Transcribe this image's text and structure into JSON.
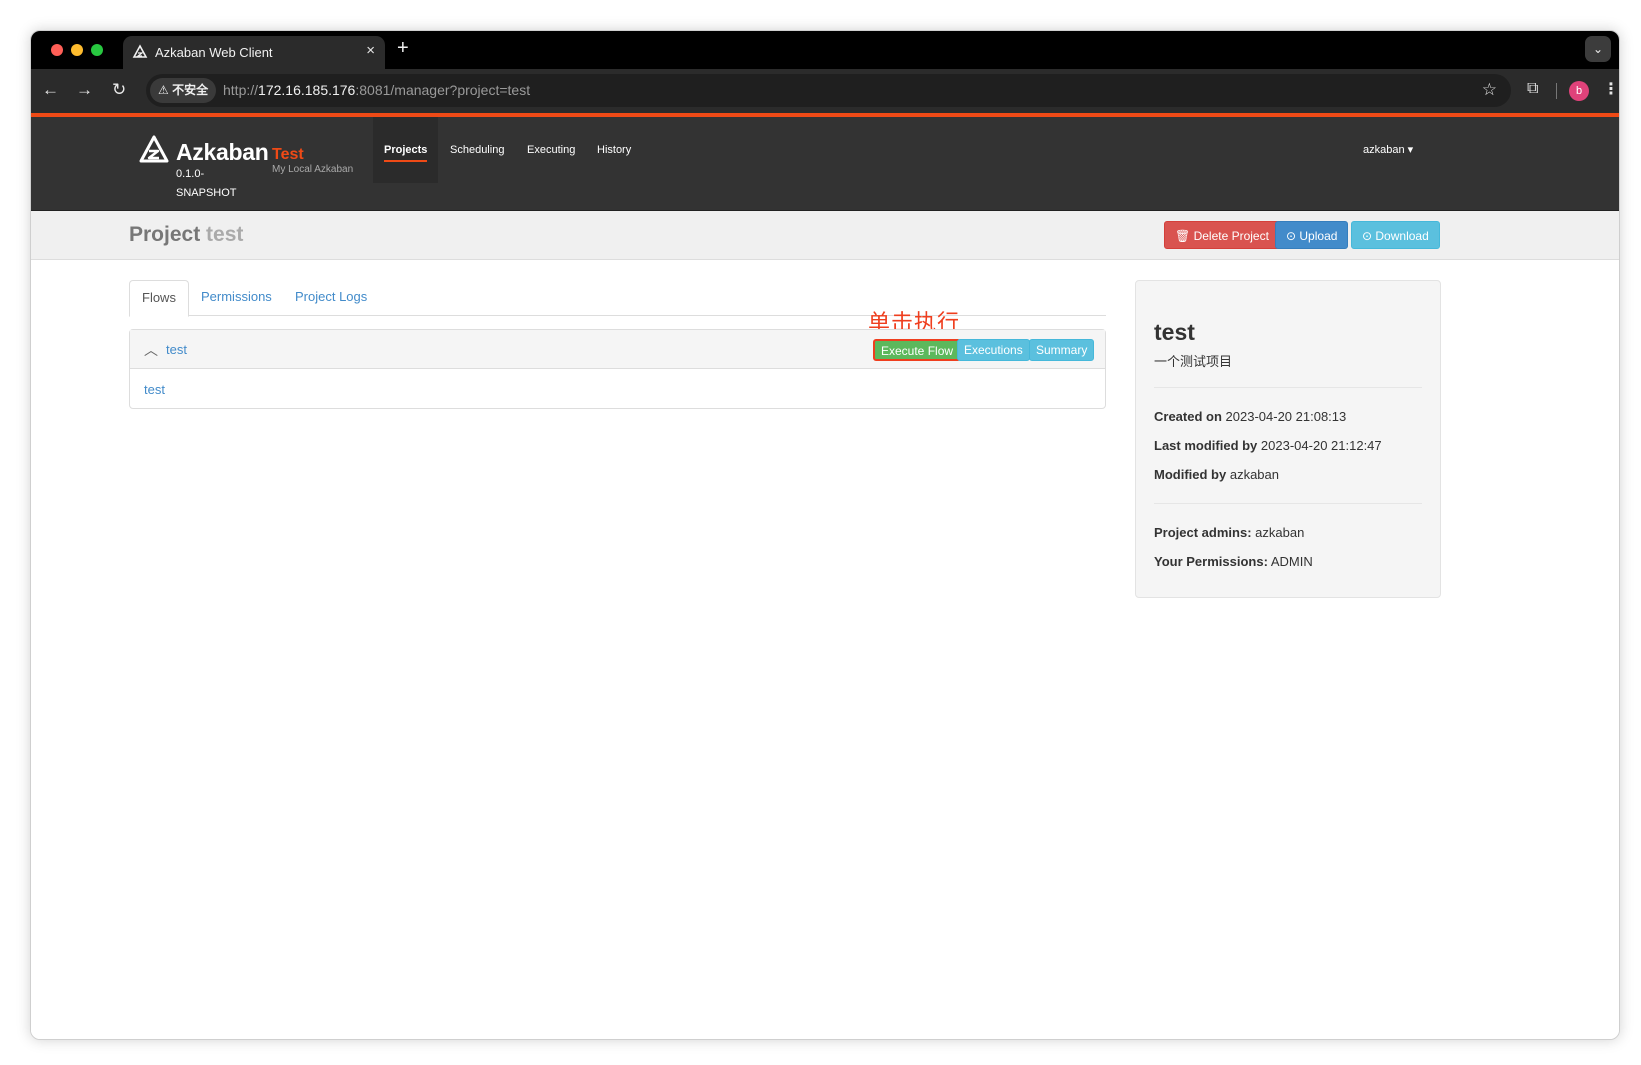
{
  "browser": {
    "tab_title": "Azkaban Web Client",
    "tab_close": "×",
    "new_tab": "+",
    "tabs_menu": "⌄",
    "security_label": "⚠ 不安全",
    "url_scheme": "http://",
    "url_host": "172.16.185.176",
    "url_rest": ":8081/manager?project=test",
    "profile_initial": "b"
  },
  "app": {
    "brand": "Azkaban",
    "version": "0.1.0-SNAPSHOT",
    "env_name": "Test",
    "env_description": "My Local Azkaban",
    "nav": [
      "Projects",
      "Scheduling",
      "Executing",
      "History"
    ],
    "active_nav": "Projects",
    "user": "azkaban ▾",
    "accent_color": "#ef4a16"
  },
  "project": {
    "label": "Project",
    "name": "test",
    "buttons": {
      "delete": "🗑 Delete Project",
      "upload": "⊙ Upload",
      "download": "⊙ Download"
    },
    "tabs": [
      "Flows",
      "Permissions",
      "Project Logs"
    ],
    "active_tab": "Flows"
  },
  "annotation": "单击执行",
  "flows": [
    {
      "name": "test",
      "actions": {
        "execute": "Execute Flow",
        "executions": "Executions",
        "summary": "Summary"
      },
      "jobs": [
        "test"
      ]
    }
  ],
  "details": {
    "title": "test",
    "description": "一个测试项目",
    "created_label": "Created on",
    "created_value": "2023-04-20 21:08:13",
    "last_modified_label": "Last modified by",
    "last_modified_value": "2023-04-20 21:12:47",
    "modified_by_label": "Modified by",
    "modified_by_value": "azkaban",
    "admins_label": "Project admins:",
    "admins_value": "azkaban",
    "permissions_label": "Your Permissions:",
    "permissions_value": "ADMIN"
  }
}
